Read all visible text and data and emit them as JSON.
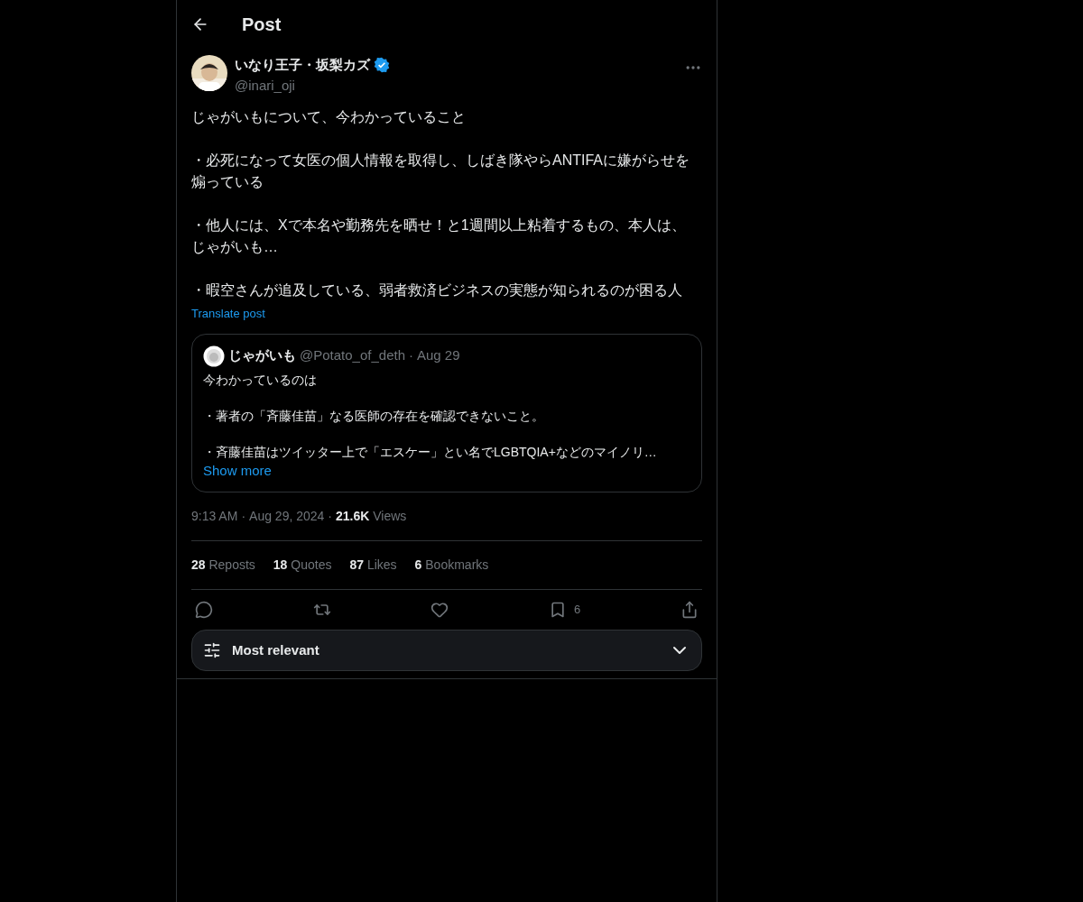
{
  "header": {
    "title": "Post"
  },
  "post": {
    "author": {
      "name": "いなり王子・坂梨カズ",
      "verified": true,
      "handle": "@inari_oji"
    },
    "paragraphs": [
      "じゃがいもについて、今わかっていること",
      "・必死になって女医の個人情報を取得し、しばき隊やらANTIFAに嫌がらせを煽っている",
      "・他人には、Xで本名や勤務先を晒せ！と1週間以上粘着するもの、本人は、じゃがいも…",
      "・暇空さんが追及している、弱者救済ビジネスの実態が知られるのが困る人"
    ],
    "translate_link": "Translate post",
    "quote": {
      "name": "じゃがいも",
      "handle": "@Potato_of_deth",
      "separator": "·",
      "date": "Aug 29",
      "paragraphs": [
        "今わかっているのは",
        "・著者の「斉藤佳苗」なる医師の存在を確認できないこと。",
        "・斉藤佳苗はツイッター上で「エスケー」とい名でLGBTQIA+などのマイノリ…"
      ],
      "show_more": "Show more"
    },
    "meta": {
      "time": "9:13 AM",
      "separator": "·",
      "date": "Aug 29, 2024",
      "views": "**21.6K** Views"
    },
    "stats": [
      "**28** Reposts",
      "**18** Quotes",
      "**87** Likes",
      "**6** Bookmarks"
    ],
    "actions": [
      {
        "kind": "reply"
      },
      {
        "kind": "repost"
      },
      {
        "kind": "like"
      },
      {
        "kind": "bookmark",
        "count": "6"
      },
      {
        "kind": "share"
      }
    ]
  },
  "sort": {
    "label": "Most relevant"
  }
}
